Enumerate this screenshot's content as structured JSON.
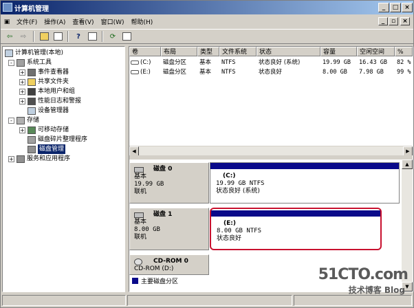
{
  "window": {
    "title": "计算机管理",
    "controls": {
      "minimize": "_",
      "restore": "□",
      "close": "×"
    }
  },
  "menu": {
    "items": [
      "文件(F)",
      "操作(A)",
      "查看(V)",
      "窗口(W)",
      "帮助(H)"
    ],
    "mdi_controls": {
      "minimize": "_",
      "restore": "▫",
      "close": "×"
    }
  },
  "toolbar": {
    "back_icon": "back-arrow-icon",
    "forward_icon": "forward-arrow-icon"
  },
  "tree": {
    "root": "计算机管理(本地)",
    "items": [
      {
        "label": "系统工具",
        "expander": "-",
        "level": 1
      },
      {
        "label": "事件查看器",
        "expander": "+",
        "level": 2
      },
      {
        "label": "共享文件夹",
        "expander": "+",
        "level": 2
      },
      {
        "label": "本地用户和组",
        "expander": "+",
        "level": 2
      },
      {
        "label": "性能日志和警报",
        "expander": "+",
        "level": 2
      },
      {
        "label": "设备管理器",
        "expander": "",
        "level": 2
      },
      {
        "label": "存储",
        "expander": "-",
        "level": 1
      },
      {
        "label": "可移动存储",
        "expander": "+",
        "level": 2
      },
      {
        "label": "磁盘碎片整理程序",
        "expander": "",
        "level": 2
      },
      {
        "label": "磁盘管理",
        "expander": "",
        "level": 2,
        "selected": true
      },
      {
        "label": "服务和应用程序",
        "expander": "+",
        "level": 1
      }
    ]
  },
  "volume_table": {
    "headers": [
      "卷",
      "布局",
      "类型",
      "文件系统",
      "状态",
      "容量",
      "空闲空间",
      "%"
    ],
    "rows": [
      [
        "(C:)",
        "磁盘分区",
        "基本",
        "NTFS",
        "状态良好 (系统)",
        "19.99 GB",
        "16.43 GB",
        "82 %"
      ],
      [
        "(E:)",
        "磁盘分区",
        "基本",
        "NTFS",
        "状态良好",
        "8.00 GB",
        "7.98 GB",
        "99 %"
      ]
    ]
  },
  "disks": [
    {
      "name": "磁盘 0",
      "type": "基本",
      "size": "19.99 GB",
      "status": "联机",
      "volume": {
        "letter": "(C:)",
        "fs": "19.99 GB NTFS",
        "state": "状态良好 (系统)"
      }
    },
    {
      "name": "磁盘 1",
      "type": "基本",
      "size": "8.00 GB",
      "status": "联机",
      "volume": {
        "letter": "(E:)",
        "fs": "8.00 GB NTFS",
        "state": "状态良好"
      }
    },
    {
      "name": "CD-ROM 0",
      "type": "CD-ROM (D:)"
    }
  ],
  "legend": {
    "label": "主要磁盘分区"
  },
  "watermark": {
    "site": "51CTO.com",
    "blog": "技术博客 Blog"
  },
  "colors": {
    "partition_bar": "#0a0a8a",
    "selection": "#0a246a",
    "highlight_border": "#c8102e"
  }
}
